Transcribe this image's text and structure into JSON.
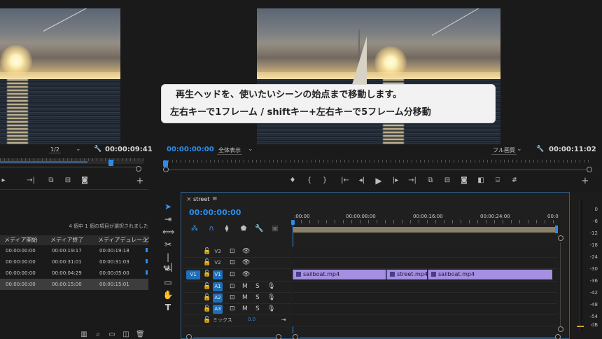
{
  "caption": {
    "line1": "再生ヘッドを、使いたいシーンの始点まで移動します。",
    "line2": "左右キーで1フレーム / shiftキー+左右キーで5フレーム分移動"
  },
  "source_monitor": {
    "zoom": "1/2",
    "timecode": "00:00:09:41"
  },
  "program_monitor": {
    "timecode_current": "00:00:00:00",
    "fit": "全体表示",
    "quality": "フル画質",
    "timecode_duration": "00:00:11:02"
  },
  "project_panel": {
    "status": "4 個中 1 個の項目が選択されました",
    "columns": [
      "メディア開始",
      "メディア終了",
      "メディアデュレーシ",
      "ビ"
    ],
    "rows": [
      {
        "start": "00:00:00:00",
        "end": "00:00:19:17",
        "duration": "00:00:19:18"
      },
      {
        "start": "00:00:00:00",
        "end": "00:00:31:01",
        "duration": "00:00:31:03"
      },
      {
        "start": "00:00:00:00",
        "end": "00:00:04:29",
        "duration": "00:00:05:00"
      },
      {
        "start": "00:00:00:00",
        "end": "00:00:15:00",
        "duration": "00:00:15:01"
      }
    ]
  },
  "timeline": {
    "close": "×",
    "name": "street",
    "menu": "≡",
    "timecode": "00:00:00:00",
    "ruler": [
      ":00:00",
      "00:00:08:00",
      "00:00:16:00",
      "00:00:24:00",
      "00:0"
    ],
    "tracks_video": [
      "V3",
      "V2",
      "V1"
    ],
    "tracks_audio": [
      "A1",
      "A2",
      "A3"
    ],
    "source_patch": "V1",
    "mute": "M",
    "solo": "S",
    "mix_label": "ミックス",
    "mix_value": "0.0",
    "clips": [
      {
        "name": "sailboat.mp4"
      },
      {
        "name": "street.mp4"
      },
      {
        "name": "sailboat.mp4"
      }
    ]
  },
  "meter": {
    "scale": [
      "0",
      "-6",
      "-12",
      "-18",
      "-24",
      "-30",
      "-36",
      "-42",
      "-48",
      "-54",
      "dB"
    ]
  },
  "colors": {
    "accent_blue": "#2d8ceb",
    "clip_purple": "#a58fe0",
    "panel_border": "#2e5f8f"
  }
}
